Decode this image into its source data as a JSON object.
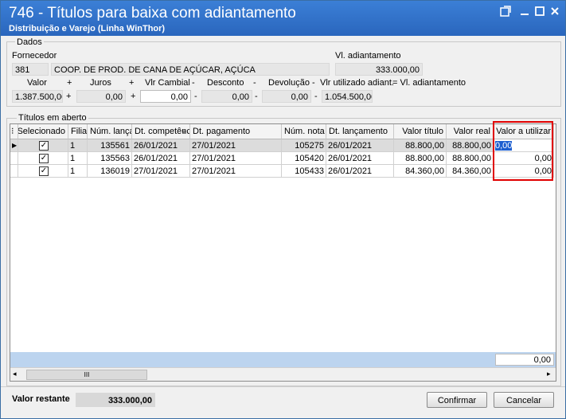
{
  "window": {
    "title": "746 - Títulos para baixa com adiantamento",
    "subtitle": "Distribuição e Varejo (Linha WinThor)",
    "restore_icon": "restore-icon",
    "minimize_icon": "minimize-icon",
    "maximize_icon": "maximize-icon",
    "close_icon": "close-icon"
  },
  "dados": {
    "group_label": "Dados",
    "fornecedor_label": "Fornecedor",
    "fornecedor_code": "381",
    "fornecedor_name": "COOP. DE PROD. DE CANA DE AÇÚCAR, AÇÚCA",
    "vl_adiantamento_label": "Vl. adiantamento",
    "vl_adiantamento": "333.000,00",
    "labels": {
      "valor": "Valor",
      "juros": "Juros",
      "vlr_cambial": "Vlr Cambial",
      "desconto": "Desconto",
      "devolucao": "Devolução",
      "vlr_utilizado": "Vlr utilizado adiant.",
      "eq_vl_adiantamento": "= Vl. adiantamento"
    },
    "ops": {
      "plus": "+",
      "minus": "-"
    },
    "values": {
      "valor": "1.387.500,00",
      "juros": "0,00",
      "vlr_cambial": "0,00",
      "desconto": "0,00",
      "devolucao": "0,00",
      "vlr_utilizado": "1.054.500,00"
    }
  },
  "titulos": {
    "group_label": "Títulos em aberto",
    "columns": {
      "selecionado": "Selecionado",
      "filial": "Filial",
      "num_lanc": "Núm. lançamento",
      "dt_competencia": "Dt. competência",
      "dt_pagamento": "Dt. pagamento",
      "num_nota": "Núm. nota",
      "dt_lancamento": "Dt. lançamento",
      "valor_titulo": "Valor título",
      "valor_real": "Valor real",
      "valor_utilizar": "Valor a utilizar"
    },
    "rows": [
      {
        "filial": "1",
        "num_lanc": "135561",
        "dt_competencia": "26/01/2021",
        "dt_pagamento": "27/01/2021",
        "num_nota": "105275",
        "dt_lancamento": "26/01/2021",
        "valor_titulo": "88.800,00",
        "valor_real": "88.800,00",
        "valor_utilizar": "0,00"
      },
      {
        "filial": "1",
        "num_lanc": "135563",
        "dt_competencia": "26/01/2021",
        "dt_pagamento": "27/01/2021",
        "num_nota": "105420",
        "dt_lancamento": "26/01/2021",
        "valor_titulo": "88.800,00",
        "valor_real": "88.800,00",
        "valor_utilizar": "0,00"
      },
      {
        "filial": "1",
        "num_lanc": "136019",
        "dt_competencia": "27/01/2021",
        "dt_pagamento": "27/01/2021",
        "num_nota": "105433",
        "dt_lancamento": "26/01/2021",
        "valor_titulo": "84.360,00",
        "valor_real": "84.360,00",
        "valor_utilizar": "0,00"
      }
    ],
    "total_utilizar": "0,00",
    "scroll_thumb": "III"
  },
  "bottom": {
    "valor_restante_label": "Valor restante",
    "valor_restante": "333.000,00",
    "confirmar": "Confirmar",
    "cancelar": "Cancelar"
  },
  "colors": {
    "titlebar": "#2a66bd",
    "selected_row": "#dcdcdc",
    "highlight": "#e00000",
    "footer": "#bcd4ef"
  }
}
